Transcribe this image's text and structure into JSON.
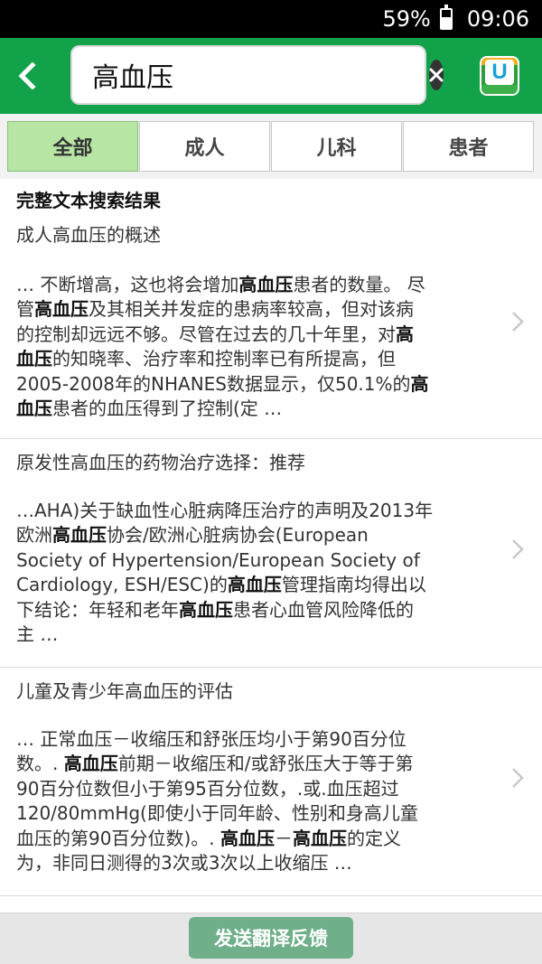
{
  "status_bar": {
    "battery_percent": "59%",
    "time": "09:06",
    "battery_level": 0.59
  },
  "search": {
    "query": "高血压"
  },
  "icons": {
    "back": "back-arrow-icon",
    "search": "search-icon",
    "clear": "clear-icon",
    "app": "app-logo-icon",
    "chevron": "chevron-right-icon"
  },
  "tabs": [
    "全部",
    "成人",
    "儿科",
    "患者"
  ],
  "active_tab": 0,
  "section_title": "完整文本搜索结果",
  "results": [
    {
      "title": "成人高血压的概述",
      "snippet_lines": [
        [
          {
            "t": "… 不断增高，这也将会增加"
          },
          {
            "t": "高血压",
            "b": true
          },
          {
            "t": "患者的数量。 尽"
          }
        ],
        [
          {
            "t": "管"
          },
          {
            "t": "高血压",
            "b": true
          },
          {
            "t": "及其相关并发症的患病率较高，但对该病"
          }
        ],
        [
          {
            "t": "的控制却远远不够。尽管在过去的几十年里，对"
          },
          {
            "t": "高",
            "b": true
          }
        ],
        [
          {
            "t": "血压",
            "b": true
          },
          {
            "t": "的知晓率、治疗率和控制率已有所提高，但"
          }
        ],
        [
          {
            "t": "2005-2008年的NHANES数据显示，仅50.1%的"
          },
          {
            "t": "高",
            "b": true
          }
        ],
        [
          {
            "t": "血压",
            "b": true
          },
          {
            "t": "患者的血压得到了控制(定 …"
          }
        ]
      ]
    },
    {
      "title": "原发性高血压的药物治疗选择：推荐",
      "snippet_lines": [
        [
          {
            "t": "…AHA)关于缺血性心脏病降压治疗的声明及2013年"
          }
        ],
        [
          {
            "t": "欧洲"
          },
          {
            "t": "高血压",
            "b": true
          },
          {
            "t": "协会/欧洲心脏病协会(European"
          }
        ],
        [
          {
            "t": "Society of Hypertension/European Society of"
          }
        ],
        [
          {
            "t": "Cardiology, ESH/ESC)的"
          },
          {
            "t": "高血压",
            "b": true
          },
          {
            "t": "管理指南均得出以"
          }
        ],
        [
          {
            "t": "下结论：年轻和老年"
          },
          {
            "t": "高血压",
            "b": true
          },
          {
            "t": "患者心血管风险降低的"
          }
        ],
        [
          {
            "t": "主 …"
          }
        ]
      ]
    },
    {
      "title": "儿童及青少年高血压的评估",
      "snippet_lines": [
        [
          {
            "t": "… 正常血压－收缩压和舒张压均小于第90百分位"
          }
        ],
        [
          {
            "t": "数。. "
          },
          {
            "t": "高血压",
            "b": true
          },
          {
            "t": "前期－收缩压和/或舒张压大于等于第"
          }
        ],
        [
          {
            "t": "90百分位数但小于第95百分位数，.或.血压超过"
          }
        ],
        [
          {
            "t": "120/80mmHg(即使小于同年龄、性别和身高儿童"
          }
        ],
        [
          {
            "t": "血压的第90百分位数)。. "
          },
          {
            "t": "高血压",
            "b": true
          },
          {
            "t": "－"
          },
          {
            "t": "高血压",
            "b": true
          },
          {
            "t": "的定义"
          }
        ],
        [
          {
            "t": "为，非同日测得的3次或3次以上收缩压 …"
          }
        ]
      ]
    }
  ],
  "feedback_button": "发送翻译反馈",
  "colors": {
    "header_green": "#12a24a",
    "active_tab": "#b7e6a4",
    "feedback_button": "#6faf8a"
  }
}
